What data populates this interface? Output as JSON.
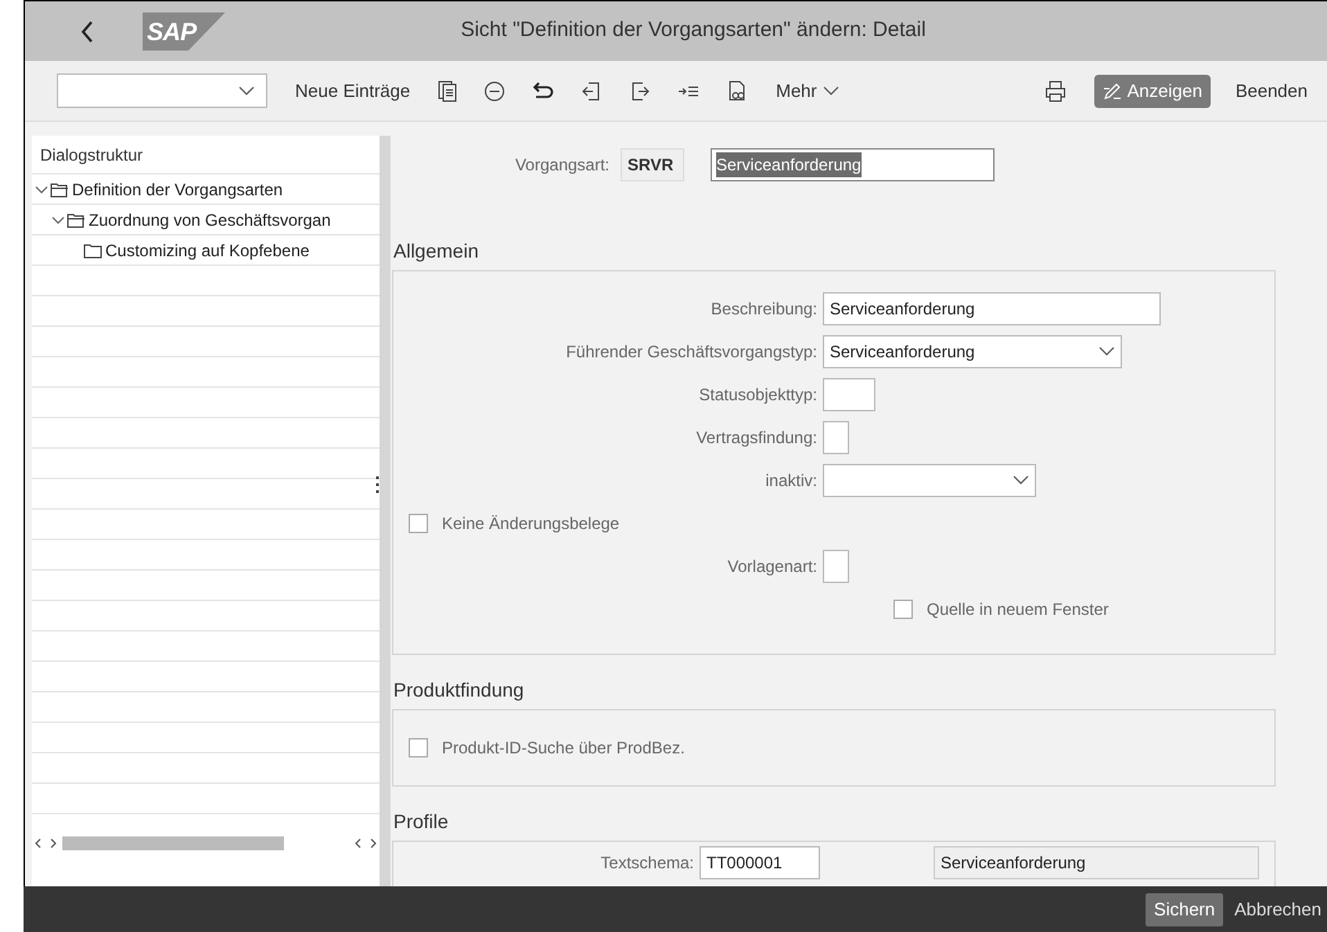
{
  "header": {
    "logo": "SAP",
    "title": "Sicht \"Definition der Vorgangsarten\" ändern: Detail"
  },
  "toolbar": {
    "new_entries": "Neue Einträge",
    "more": "Mehr",
    "display": "Anzeigen",
    "exit": "Beenden"
  },
  "tree": {
    "title": "Dialogstruktur",
    "items": [
      {
        "label": "Definition der Vorgangsarten",
        "expanded": true,
        "children": [
          {
            "label": "Zuordnung von Geschäftsvorgan",
            "expanded": true,
            "children": [
              {
                "label": "Customizing auf Kopfebene"
              }
            ]
          }
        ]
      }
    ]
  },
  "key": {
    "label": "Vorgangsart:",
    "code": "SRVR",
    "description": "Serviceanforderung",
    "highlighted": true
  },
  "sections": [
    {
      "title": "Allgemein",
      "fields": [
        {
          "kind": "text",
          "label": "Beschreibung:",
          "value": "Serviceanforderung"
        },
        {
          "kind": "select",
          "label": "Führender Geschäftsvorgangstyp:",
          "value": "Serviceanforderung"
        },
        {
          "kind": "code",
          "label": "Statusobjekttyp:"
        },
        {
          "kind": "flag",
          "label": "Vertragsfindung:"
        },
        {
          "kind": "dropdown",
          "label": "inaktiv:"
        },
        {
          "kind": "checkbox",
          "label": "Keine Änderungsbelege",
          "checked": false
        },
        {
          "kind": "flag",
          "label": "Vorlagenart:"
        },
        {
          "kind": "subcheckbox",
          "label": "Quelle in neuem Fenster",
          "checked": false
        }
      ]
    },
    {
      "title": "Produktfindung",
      "fields": [
        {
          "kind": "checkbox",
          "label": "Produkt-ID-Suche über ProdBez.",
          "checked": false
        }
      ]
    },
    {
      "title": "Profile",
      "fields": [
        {
          "kind": "pair",
          "label": "Textschema:",
          "value": "TT000001",
          "description": "Serviceanforderung"
        }
      ]
    }
  ],
  "footer": {
    "save": "Sichern",
    "cancel": "Abbrechen"
  }
}
